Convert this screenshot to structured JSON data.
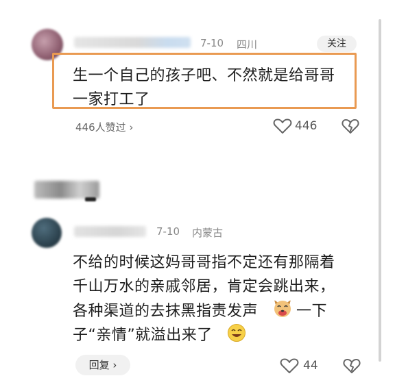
{
  "comment1": {
    "date": "7-10",
    "location": "四川",
    "follow_label": "关注",
    "lines": [
      "生一个自己的孩子吧、不然就是给哥哥",
      "一家打工了"
    ],
    "likes_text": "446人赞过 ›",
    "heart_count": "446"
  },
  "comment2": {
    "date": "7-10",
    "location": "内蒙古",
    "lines": [
      "不给的时候这妈哥哥指不定还有那隔着",
      "千山万水的亲戚邻居，肯定会跳出来，",
      "各种渠道的去抹黑指责发声",
      "一下",
      "子“亲情”就溢出来了"
    ],
    "reply_label": "回复 ›",
    "heart_count": "44"
  },
  "icons": {
    "heart": "heart-icon",
    "dislike": "dislike-icon",
    "laugh_dog": "dog-laugh-emoji",
    "laugh": "laugh-emoji"
  },
  "colors": {
    "highlight": "#e99a52"
  }
}
